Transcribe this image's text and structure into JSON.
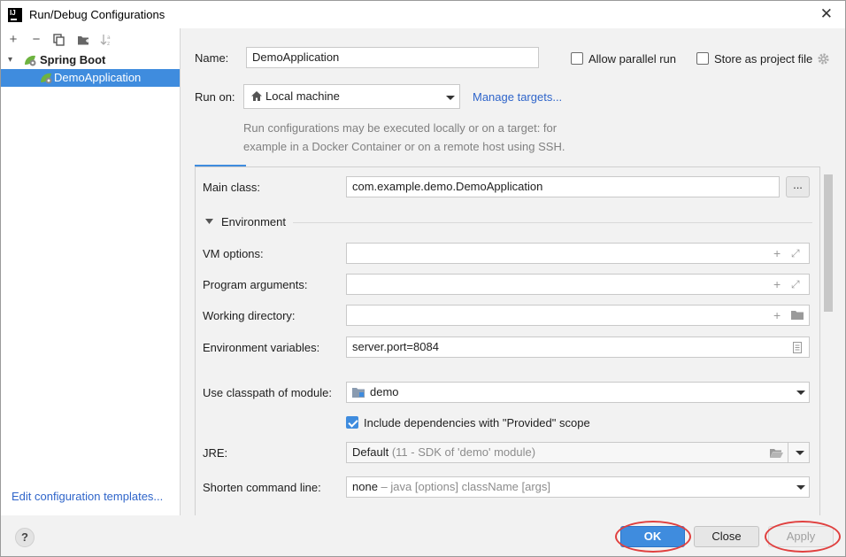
{
  "window": {
    "title": "Run/Debug Configurations"
  },
  "toolbar": {
    "add": "+",
    "remove": "−"
  },
  "tree": {
    "group": "Spring Boot",
    "item": "DemoApplication"
  },
  "sidebar_link": "Edit configuration templates...",
  "form": {
    "name_label": "Name:",
    "name_value": "DemoApplication",
    "allow_parallel": "Allow parallel run",
    "store_project": "Store as project file",
    "run_on_label": "Run on:",
    "run_on_value": "Local machine",
    "manage_targets": "Manage targets...",
    "hint_line1": "Run configurations may be executed locally or on a target: for",
    "hint_line2": "example in a Docker Container or on a remote host using SSH.",
    "main_class_label": "Main class:",
    "main_class_value": "com.example.demo.DemoApplication",
    "ellipsis": "...",
    "environment_label": "Environment",
    "vm_options_label": "VM options:",
    "program_args_label": "Program arguments:",
    "working_dir_label": "Working directory:",
    "env_vars_label": "Environment variables:",
    "env_vars_value": "server.port=8084",
    "classpath_label": "Use classpath of module:",
    "classpath_value": "demo",
    "include_deps": "Include dependencies with \"Provided\" scope",
    "jre_label": "JRE:",
    "jre_value": "Default",
    "jre_detail": "(11 - SDK of 'demo' module)",
    "shorten_label": "Shorten command line:",
    "shorten_value": "none",
    "shorten_detail": "– java [options] className [args]"
  },
  "buttons": {
    "help": "?",
    "ok": "OK",
    "close": "Close",
    "apply": "Apply"
  },
  "colors": {
    "accent": "#3f8cde",
    "highlight_ring": "#e0403f",
    "link": "#2f65ca"
  }
}
